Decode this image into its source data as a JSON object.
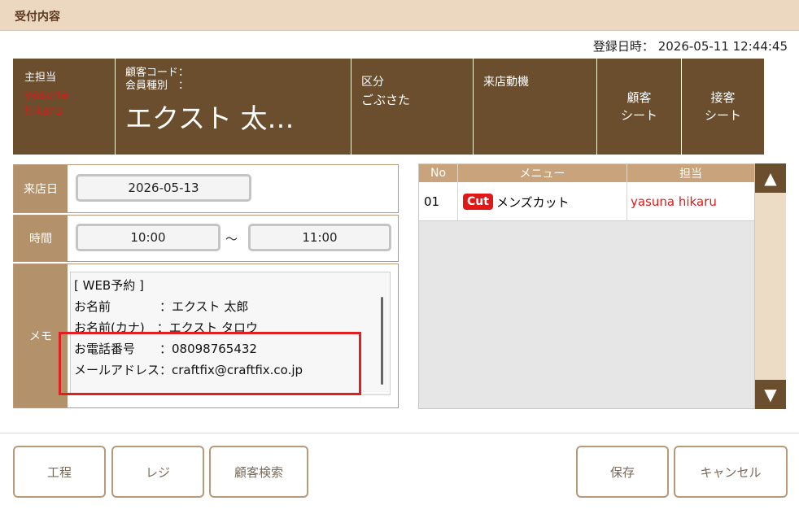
{
  "title_bar": {
    "title": "受付内容"
  },
  "registration": {
    "label": "登録日時：",
    "datetime": "2026-05-11 12:44:45"
  },
  "header": {
    "staff_label": "主担当",
    "staff_name": "yasuna hikaru",
    "customer_code_label": "顧客コード：",
    "member_type_label": "会員種別　：",
    "customer_name": "エクスト 太…",
    "category_label": "区分",
    "category_value": "ごぶさた",
    "motive_label": "来店動機",
    "customer_sheet_button_line1": "顧客",
    "customer_sheet_button_line2": "シート",
    "service_sheet_button_line1": "接客",
    "service_sheet_button_line2": "シート"
  },
  "form": {
    "visit_date_label": "来店日",
    "visit_date": "2026-05-13",
    "time_label": "時間",
    "start_time": "10:00",
    "time_separator": "～",
    "end_time": "11:00",
    "memo_label": "メモ",
    "memo_lines": [
      "[ WEB予約 ]",
      "お名前　　　　：エクスト 太郎",
      "お名前(カナ)　：エクスト タロウ",
      "お電話番号　　：08098765432",
      "メールアドレス：craftfix@craftfix.co.jp"
    ]
  },
  "menu_table": {
    "columns": [
      "No",
      "メニュー",
      "担当"
    ],
    "rows": [
      {
        "no": "01",
        "badge": "Cut",
        "menu": "メンズカット",
        "staff": "yasuna hikaru"
      }
    ],
    "scroll_up_icon": "triangle-up-icon",
    "scroll_down_icon": "triangle-down-icon"
  },
  "footer": {
    "process_button": "工程",
    "register_button": "レジ",
    "customer_search_button": "顧客検索",
    "save_button": "保存",
    "cancel_button": "キャンセル"
  },
  "colors": {
    "header_brown": "#6a4e2e",
    "label_tan": "#b3916a",
    "table_header": "#c9a37c",
    "accent_red": "#e01818",
    "title_bar": "#ecd7c0"
  }
}
